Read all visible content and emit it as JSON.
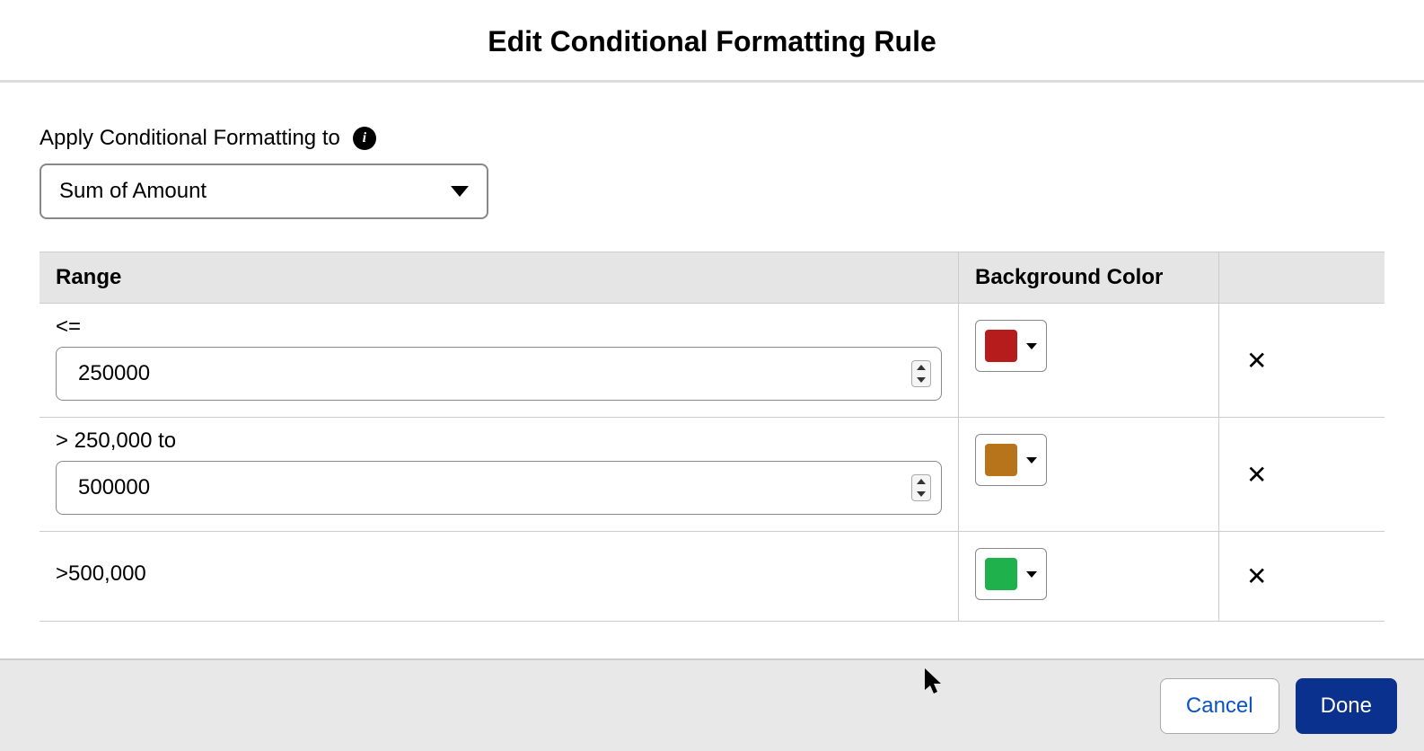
{
  "header": {
    "title": "Edit Conditional Formatting Rule"
  },
  "apply_to": {
    "label": "Apply Conditional Formatting to",
    "selected": "Sum of Amount"
  },
  "table": {
    "headers": {
      "range": "Range",
      "bg_color": "Background Color"
    },
    "rows": [
      {
        "operator": "<=",
        "value": "250000",
        "show_input": true,
        "color": "#b71c1c"
      },
      {
        "operator": "> 250,000 to",
        "value": "500000",
        "show_input": true,
        "color": "#b8741b"
      },
      {
        "operator": ">500,000",
        "value": "",
        "show_input": false,
        "color": "#1fb14b"
      }
    ]
  },
  "footer": {
    "cancel": "Cancel",
    "done": "Done"
  }
}
